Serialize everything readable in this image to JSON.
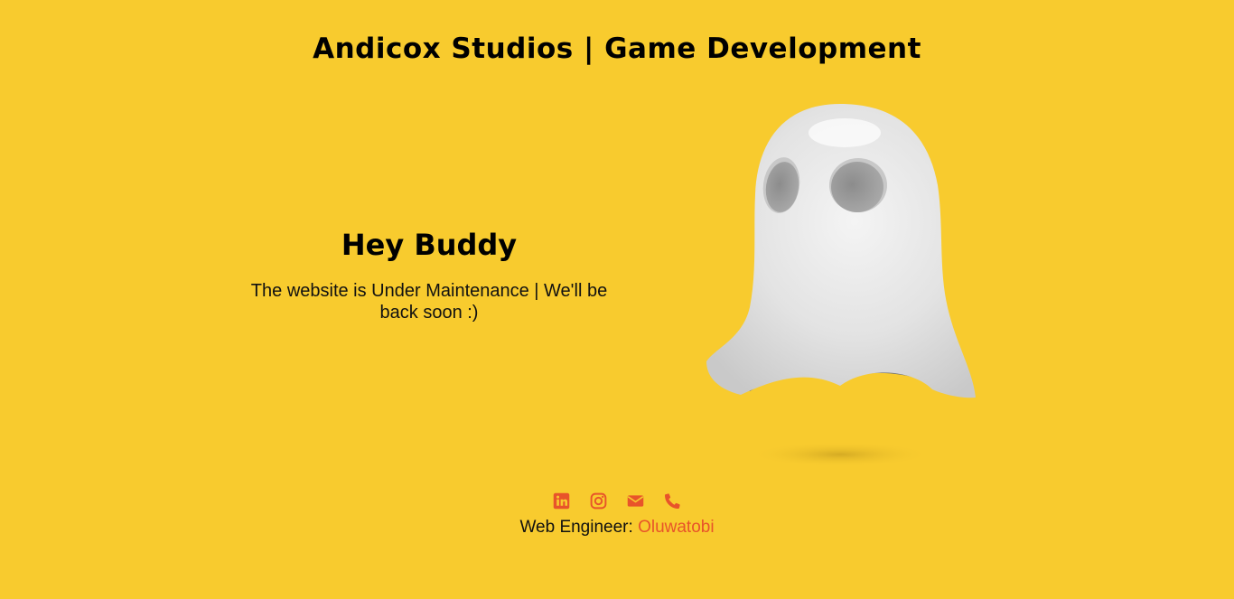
{
  "header": {
    "title": "Andicox Studios | Game Development"
  },
  "main": {
    "heading": "Hey Buddy",
    "message": "The website is Under Maintenance | We'll be back soon :)",
    "illustration": "ghost-illustration"
  },
  "footer": {
    "socials": [
      {
        "name": "linkedin-icon"
      },
      {
        "name": "instagram-icon"
      },
      {
        "name": "envelope-icon"
      },
      {
        "name": "phone-icon"
      }
    ],
    "credit_label": "Web Engineer: ",
    "credit_name": "Oluwatobi"
  },
  "colors": {
    "background": "#f8cb2e",
    "accent": "#e8542a",
    "text": "#000000"
  }
}
